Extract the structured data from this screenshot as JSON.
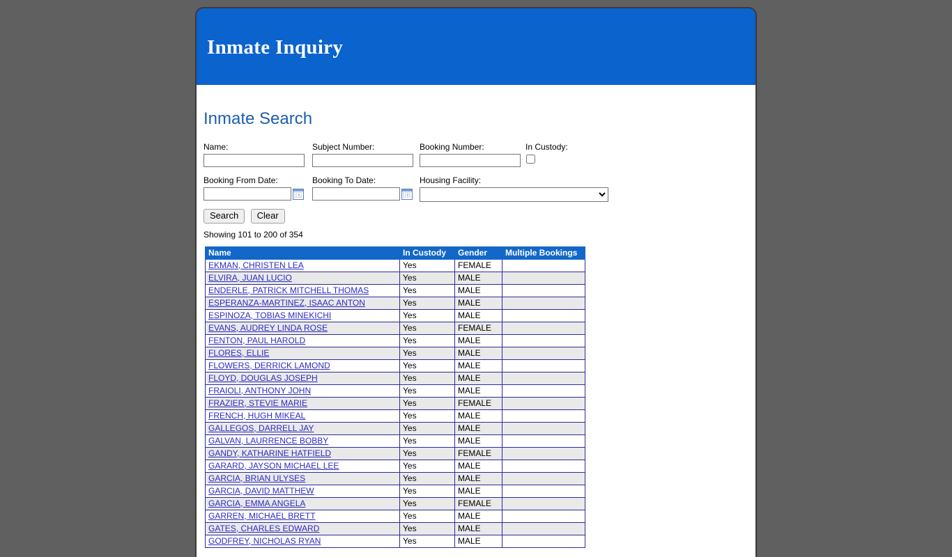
{
  "app": {
    "title": "Inmate Inquiry",
    "header_color": "#0b63ce"
  },
  "section": {
    "title": "Inmate Search"
  },
  "search_form": {
    "name": {
      "label": "Name:",
      "value": "",
      "placeholder": ""
    },
    "subject_number": {
      "label": "Subject Number:",
      "value": "",
      "placeholder": ""
    },
    "booking_number": {
      "label": "Booking Number:",
      "value": "",
      "placeholder": ""
    },
    "in_custody": {
      "label": "In Custody:",
      "checked": false
    },
    "booking_from_date": {
      "label": "Booking From Date:",
      "value": "",
      "placeholder": ""
    },
    "booking_to_date": {
      "label": "Booking To Date:",
      "value": "",
      "placeholder": ""
    },
    "housing_facility": {
      "label": "Housing Facility:",
      "selected": "",
      "options": [
        ""
      ]
    },
    "search_button": "Search",
    "clear_button": "Clear"
  },
  "results": {
    "showing_text": "Showing 101 to 200 of 354",
    "columns": [
      "Name",
      "In Custody",
      "Gender",
      "Multiple Bookings"
    ],
    "rows": [
      {
        "name": "EKMAN, CHRISTEN LEA",
        "in_custody": "Yes",
        "gender": "FEMALE",
        "multiple_bookings": ""
      },
      {
        "name": "ELVIRA, JUAN LUCIO",
        "in_custody": "Yes",
        "gender": "MALE",
        "multiple_bookings": ""
      },
      {
        "name": "ENDERLE, PATRICK MITCHELL THOMAS",
        "in_custody": "Yes",
        "gender": "MALE",
        "multiple_bookings": ""
      },
      {
        "name": "ESPERANZA-MARTINEZ, ISAAC ANTON",
        "in_custody": "Yes",
        "gender": "MALE",
        "multiple_bookings": ""
      },
      {
        "name": "ESPINOZA, TOBIAS MINEKICHI",
        "in_custody": "Yes",
        "gender": "MALE",
        "multiple_bookings": ""
      },
      {
        "name": "EVANS, AUDREY LINDA ROSE",
        "in_custody": "Yes",
        "gender": "FEMALE",
        "multiple_bookings": ""
      },
      {
        "name": "FENTON, PAUL HAROLD",
        "in_custody": "Yes",
        "gender": "MALE",
        "multiple_bookings": ""
      },
      {
        "name": "FLORES, ELLIE",
        "in_custody": "Yes",
        "gender": "MALE",
        "multiple_bookings": ""
      },
      {
        "name": "FLOWERS, DERRICK LAMOND",
        "in_custody": "Yes",
        "gender": "MALE",
        "multiple_bookings": ""
      },
      {
        "name": "FLOYD, DOUGLAS JOSEPH",
        "in_custody": "Yes",
        "gender": "MALE",
        "multiple_bookings": ""
      },
      {
        "name": "FRAIOLI, ANTHONY JOHN",
        "in_custody": "Yes",
        "gender": "MALE",
        "multiple_bookings": ""
      },
      {
        "name": "FRAZIER, STEVIE MARIE",
        "in_custody": "Yes",
        "gender": "FEMALE",
        "multiple_bookings": ""
      },
      {
        "name": "FRENCH, HUGH MIKEAL",
        "in_custody": "Yes",
        "gender": "MALE",
        "multiple_bookings": ""
      },
      {
        "name": "GALLEGOS, DARRELL JAY",
        "in_custody": "Yes",
        "gender": "MALE",
        "multiple_bookings": ""
      },
      {
        "name": "GALVAN, LAURRENCE BOBBY",
        "in_custody": "Yes",
        "gender": "MALE",
        "multiple_bookings": ""
      },
      {
        "name": "GANDY, KATHARINE HATFIELD",
        "in_custody": "Yes",
        "gender": "FEMALE",
        "multiple_bookings": ""
      },
      {
        "name": "GARARD, JAYSON MICHAEL LEE",
        "in_custody": "Yes",
        "gender": "MALE",
        "multiple_bookings": ""
      },
      {
        "name": "GARCIA, BRIAN ULYSES",
        "in_custody": "Yes",
        "gender": "MALE",
        "multiple_bookings": ""
      },
      {
        "name": "GARCIA, DAVID MATTHEW",
        "in_custody": "Yes",
        "gender": "MALE",
        "multiple_bookings": ""
      },
      {
        "name": "GARCIA, EMMA ANGELA",
        "in_custody": "Yes",
        "gender": "FEMALE",
        "multiple_bookings": ""
      },
      {
        "name": "GARREN, MICHAEL BRETT",
        "in_custody": "Yes",
        "gender": "MALE",
        "multiple_bookings": ""
      },
      {
        "name": "GATES, CHARLES EDWARD",
        "in_custody": "Yes",
        "gender": "MALE",
        "multiple_bookings": ""
      },
      {
        "name": "GODFREY, NICHOLAS RYAN",
        "in_custody": "Yes",
        "gender": "MALE",
        "multiple_bookings": ""
      }
    ]
  },
  "icons": {
    "calendar": "calendar-icon",
    "dropdown": "chevron-down-icon"
  }
}
